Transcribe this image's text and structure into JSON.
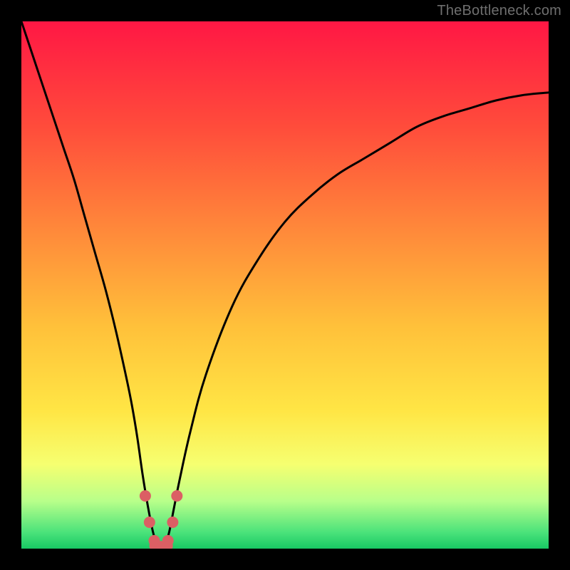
{
  "watermark": "TheBottleneck.com",
  "chart_data": {
    "type": "line",
    "title": "",
    "xlabel": "",
    "ylabel": "",
    "xlim": [
      0,
      100
    ],
    "ylim": [
      0,
      100
    ],
    "grid": false,
    "legend": false,
    "gradient_stops": [
      {
        "offset": 0.0,
        "color": "#ff1744"
      },
      {
        "offset": 0.2,
        "color": "#ff4c3b"
      },
      {
        "offset": 0.4,
        "color": "#ff8a3a"
      },
      {
        "offset": 0.58,
        "color": "#ffc13a"
      },
      {
        "offset": 0.74,
        "color": "#ffe645"
      },
      {
        "offset": 0.84,
        "color": "#f6ff70"
      },
      {
        "offset": 0.91,
        "color": "#b8ff8a"
      },
      {
        "offset": 0.97,
        "color": "#49e27a"
      },
      {
        "offset": 1.0,
        "color": "#18c864"
      }
    ],
    "series": [
      {
        "name": "bottleneck-curve",
        "x": [
          0,
          2,
          4,
          6,
          8,
          10,
          12,
          14,
          16,
          18,
          20,
          21,
          22,
          23,
          24,
          25,
          26,
          27,
          28,
          29,
          30,
          32,
          35,
          40,
          45,
          50,
          55,
          60,
          65,
          70,
          75,
          80,
          85,
          90,
          95,
          100
        ],
        "y": [
          100,
          94,
          88,
          82,
          76,
          70,
          63,
          56,
          49,
          41,
          32,
          27,
          21,
          14,
          8,
          3,
          0,
          0,
          3,
          8,
          13,
          22,
          33,
          46,
          55,
          62,
          67,
          71,
          74,
          77,
          80,
          82,
          83.5,
          85,
          86,
          86.5
        ]
      }
    ],
    "markers": {
      "name": "highlight-dots",
      "color": "#db5f64",
      "radius": 8,
      "points": [
        {
          "x": 23.5,
          "y": 10
        },
        {
          "x": 24.3,
          "y": 5
        },
        {
          "x": 25.2,
          "y": 1.5
        },
        {
          "x": 27.8,
          "y": 1.5
        },
        {
          "x": 28.7,
          "y": 5
        },
        {
          "x": 29.5,
          "y": 10
        }
      ]
    },
    "flat_segment": {
      "name": "curve-bottom",
      "color": "#db5f64",
      "width": 14,
      "x0": 25.2,
      "x1": 27.8,
      "y": 0.5
    }
  }
}
